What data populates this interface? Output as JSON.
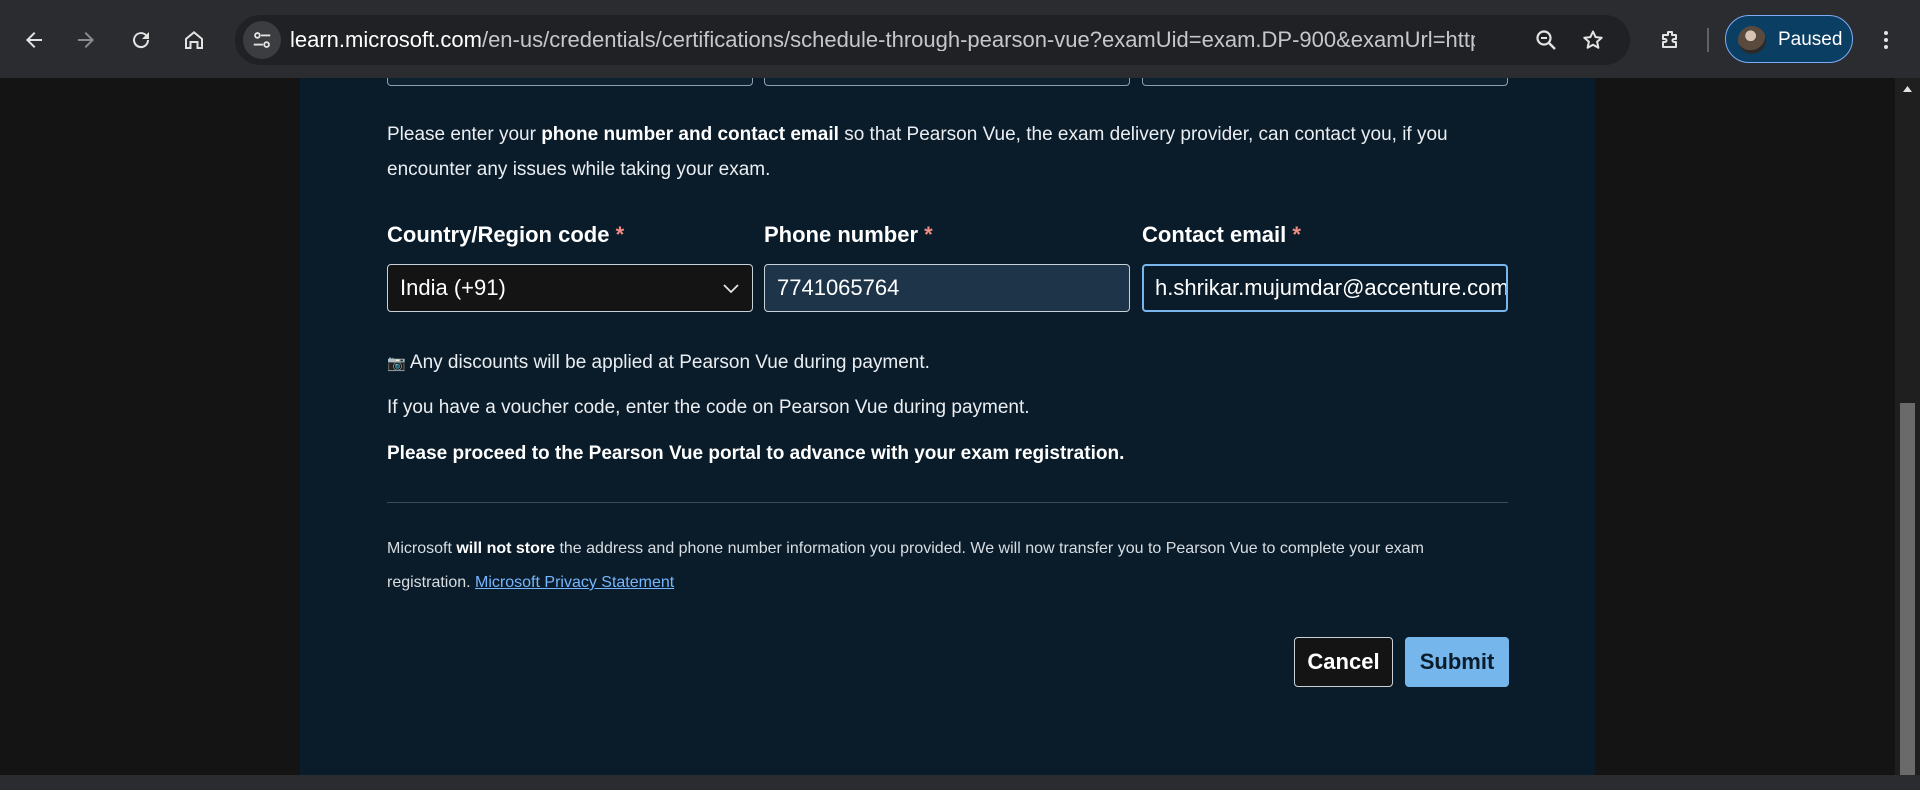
{
  "browser": {
    "url_host": "learn.microsoft.com",
    "url_path": "/en-us/credentials/certifications/schedule-through-pearson-vue?examUid=exam.DP-900&examUrl=https%3A...",
    "profile_label": "Paused",
    "accent_color": "#7cacf8"
  },
  "form": {
    "intro_prefix": "Please enter your ",
    "intro_bold": "phone number and contact email",
    "intro_suffix": " so that Pearson Vue, the exam delivery provider, can contact you, if you encounter any issues while taking your exam.",
    "country_label": "Country/Region code",
    "phone_label": "Phone number",
    "email_label": "Contact email",
    "required_mark": "*",
    "country_value": "India (+91)",
    "phone_value": "7741065764",
    "email_value": "h.shrikar.mujumdar@accenture.com",
    "discount_icon": "📷",
    "discount_text": " Any discounts will be applied at Pearson Vue during payment.",
    "voucher_text": "If you have a voucher code, enter the code on Pearson Vue during payment.",
    "proceed_text": "Please proceed to the Pearson Vue portal to advance with your exam registration.",
    "privacy_prefix": "Microsoft ",
    "privacy_bold": "will not store",
    "privacy_suffix": " the address and phone number information you provided. We will now transfer you to Pearson Vue to complete your exam registration. ",
    "privacy_link": "Microsoft Privacy Statement",
    "cancel_label": "Cancel",
    "submit_label": "Submit"
  }
}
